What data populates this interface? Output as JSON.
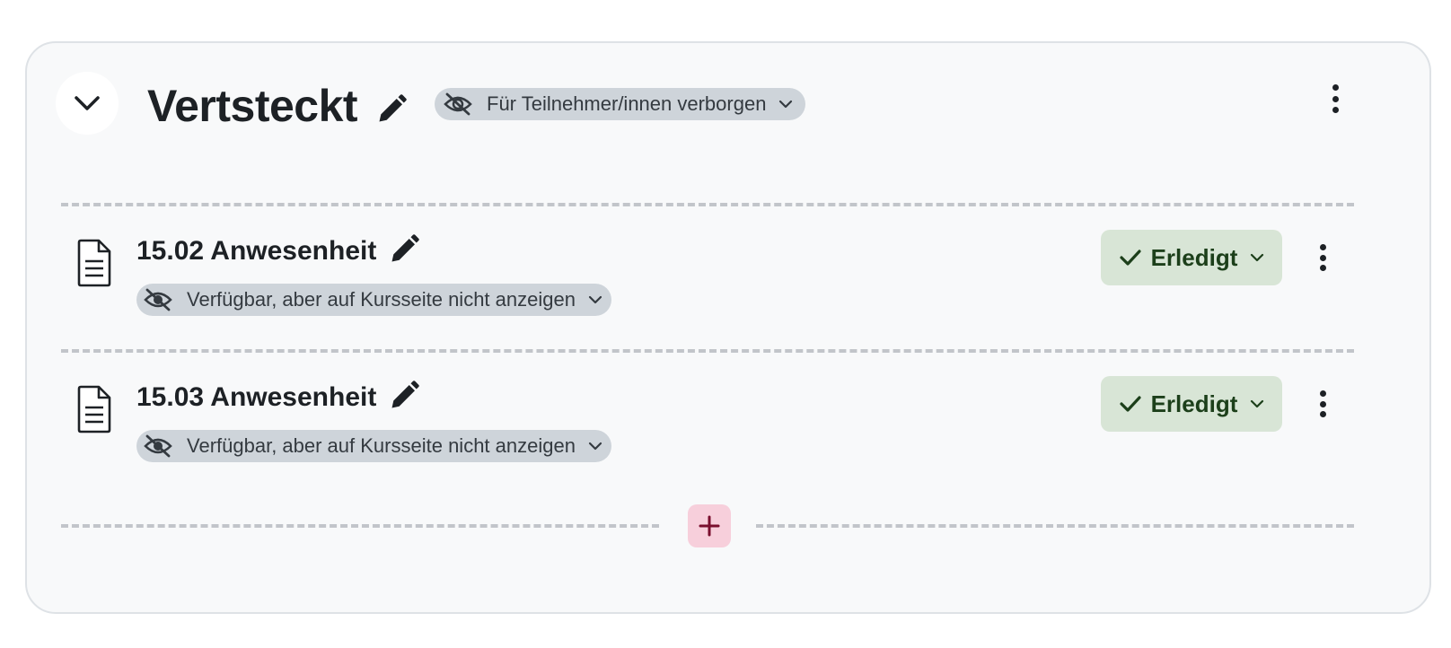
{
  "section": {
    "title": "Vertsteckt",
    "visibility_badge": "Für Teilnehmer/innen verborgen",
    "icons": {
      "collapse": "chevron-down-icon",
      "edit": "pencil-icon",
      "visibility": "eye-slash-icon",
      "menu": "vertical-dots-icon"
    }
  },
  "activities": [
    {
      "title": "15.02 Anwesenheit",
      "visibility_badge": "Verfügbar, aber auf Kursseite nicht anzeigen",
      "completion_label": "Erledigt"
    },
    {
      "title": "15.03 Anwesenheit",
      "visibility_badge": "Verfügbar, aber auf Kursseite nicht anzeigen",
      "completion_label": "Erledigt"
    }
  ],
  "colors": {
    "section_bg": "#f8f9fa",
    "badge_bg": "#ced4da",
    "done_bg": "#d8e5d6",
    "done_text": "#1c3f1a",
    "add_bg": "#f7cfdb",
    "add_icon": "#7a0f2e"
  }
}
